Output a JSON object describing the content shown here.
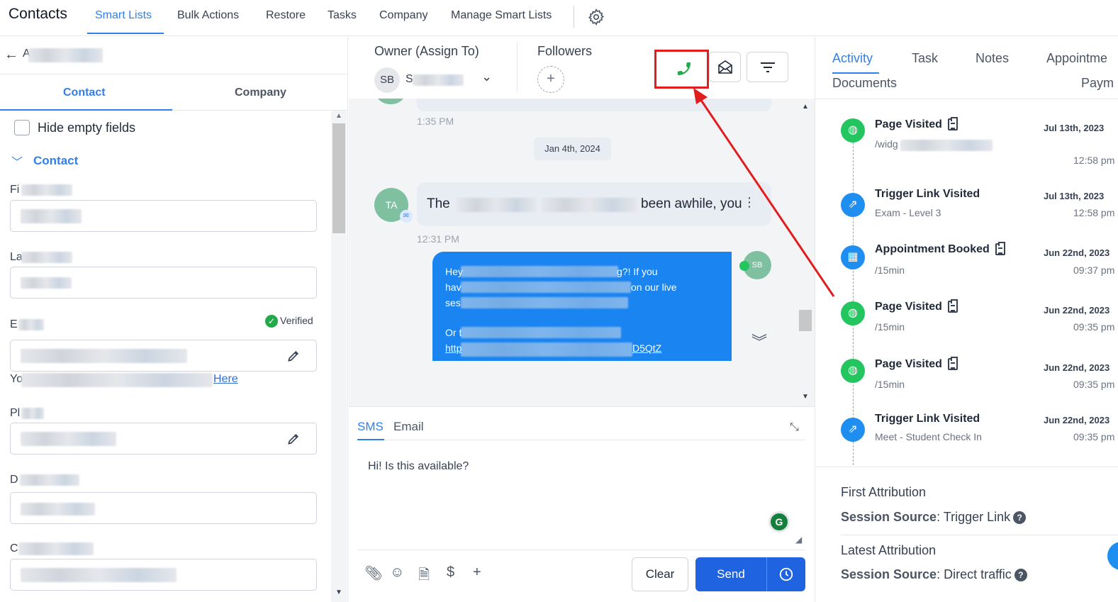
{
  "topnav": {
    "title": "Contacts",
    "items": [
      "Smart Lists",
      "Bulk Actions",
      "Restore",
      "Tasks",
      "Company",
      "Manage Smart Lists"
    ],
    "active": "Smart Lists"
  },
  "left": {
    "back_name": "A            rton",
    "tabs": [
      "Contact",
      "Company"
    ],
    "hide_empty_label": "Hide empty fields",
    "section_label": "Contact",
    "field_labels": [
      "Fi",
      "La",
      "E",
      "Pl",
      "D",
      "C"
    ],
    "verified_label": "Verified",
    "here_link": "Here",
    "yo_prefix": "Yo"
  },
  "middle": {
    "owner_label": "Owner (Assign To)",
    "owner_initials": "SB",
    "owner_name": "S          ...",
    "followers_label": "Followers",
    "time1": "1:35 PM",
    "date_chip": "Jan 4th, 2024",
    "ta_initials": "TA",
    "bubble_in_start": "The",
    "bubble_in_end": "been awhile, you",
    "time2": "12:31 PM",
    "bubble_out": {
      "l1_start": "Hey",
      "l1_end": "g?! If you",
      "l2_start": "hav",
      "l2_end": "on our live",
      "l3_start": "ses",
      "l4_start": "Or t",
      "l5_start": "http",
      "l5_end": "D5QtZ"
    },
    "sb_initials": "SB",
    "composer": {
      "tabs": [
        "SMS",
        "Email"
      ],
      "message": "Hi! Is this available?",
      "clear_label": "Clear",
      "send_label": "Send",
      "grammarly": "G"
    }
  },
  "right": {
    "tabs_row1": [
      "Activity",
      "Task",
      "Notes",
      "Appointme"
    ],
    "tabs_row2": [
      "Documents",
      "Paym"
    ],
    "activities": [
      {
        "title": "Page Visited",
        "sub": "/widg                        d6IbJjUJFViC",
        "date": "Jul 13th, 2023",
        "time": "12:58 pm",
        "icon": "globe-icon",
        "color": "green"
      },
      {
        "title": "Trigger Link Visited",
        "sub": "Exam - Level 3",
        "date": "Jul 13th, 2023",
        "time": "12:58 pm",
        "icon": "external-link-icon",
        "color": "blue"
      },
      {
        "title": "Appointment Booked",
        "sub": "/15min",
        "date": "Jun 22nd, 2023",
        "time": "09:37 pm",
        "icon": "calendar-icon",
        "color": "blue"
      },
      {
        "title": "Page Visited",
        "sub": "/15min",
        "date": "Jun 22nd, 2023",
        "time": "09:35 pm",
        "icon": "globe-icon",
        "color": "green"
      },
      {
        "title": "Page Visited",
        "sub": "/15min",
        "date": "Jun 22nd, 2023",
        "time": "09:35 pm",
        "icon": "globe-icon",
        "color": "green"
      },
      {
        "title": "Trigger Link Visited",
        "sub": "Meet - Student Check In",
        "date": "Jun 22nd, 2023",
        "time": "09:35 pm",
        "icon": "external-link-icon",
        "color": "blue"
      }
    ],
    "first_attribution": {
      "title": "First Attribution",
      "key": "Session Source",
      "value": "Trigger Link"
    },
    "latest_attribution": {
      "title": "Latest Attribution",
      "key": "Session Source",
      "value": "Direct traffic"
    }
  },
  "colors": {
    "accent": "#2f80ed",
    "send": "#1f63e0",
    "bubble_out": "#1a84f0",
    "annotation": "#e11d1d",
    "call": "#22a94a"
  }
}
